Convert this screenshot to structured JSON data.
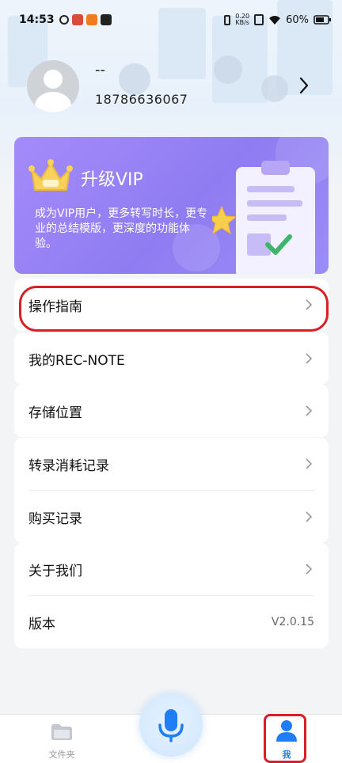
{
  "status_bar": {
    "time": "14:53",
    "speed_value": "0.20",
    "speed_unit": "KB/s",
    "battery": "60%"
  },
  "profile": {
    "nickname": "--",
    "phone": "18786636067"
  },
  "vip": {
    "title": "升级VIP",
    "description": "成为VIP用户，更多转写时长，更专业的总结模版，更深度的功能体验。"
  },
  "menu": {
    "guide": "操作指南",
    "rec_note": "我的REC-NOTE",
    "storage": "存储位置",
    "transcribe_records": "转录消耗记录",
    "purchase_records": "购买记录",
    "about": "关于我们",
    "version_label": "版本",
    "version_value": "V2.0.15"
  },
  "nav": {
    "files": "文件夹",
    "me": "我"
  },
  "colors": {
    "accent": "#1f7ef5",
    "vip_purple": "#9b86f7",
    "highlight_red": "#d91f26"
  },
  "icons": {
    "profile_arrow": "chevron-right-icon",
    "files": "folder-icon",
    "mic": "microphone-icon",
    "me": "person-icon"
  }
}
